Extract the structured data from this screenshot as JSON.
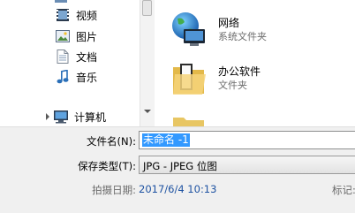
{
  "nav": {
    "items": [
      {
        "label": "视频",
        "icon": "video-library-icon"
      },
      {
        "label": "图片",
        "icon": "picture-library-icon"
      },
      {
        "label": "文档",
        "icon": "document-library-icon"
      },
      {
        "label": "音乐",
        "icon": "music-library-icon"
      },
      {
        "label": "计算机",
        "icon": "computer-icon"
      }
    ]
  },
  "files": [
    {
      "name": "网络",
      "type": "系统文件夹",
      "icon": "network-globe-icon"
    },
    {
      "name": "办公软件",
      "type": "文件夹",
      "icon": "folder-icon"
    }
  ],
  "form": {
    "filename_label": "文件名(N):",
    "filename_value": "未命名 -1",
    "savetype_label": "保存类型(T):",
    "savetype_value": "JPG - JPEG 位图",
    "date_label": "拍摄日期:",
    "date_value": "2017/6/4 10:13",
    "tags_label": "标记:"
  }
}
